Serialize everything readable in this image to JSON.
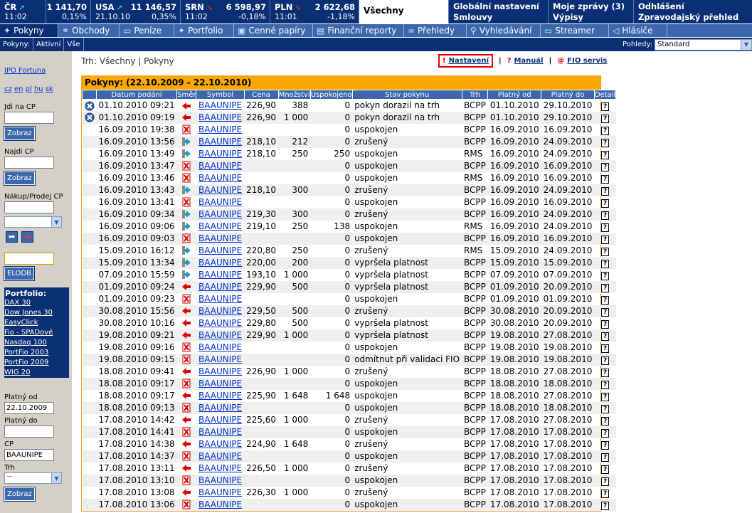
{
  "indices": [
    {
      "name": "ČR",
      "value": "1 141,70",
      "time": "11:02",
      "change": "0,15%",
      "dir": "up"
    },
    {
      "name": "USA",
      "value": "11 146,57",
      "time": "21.10.10",
      "change": "0,35%",
      "dir": "up"
    },
    {
      "name": "SRN",
      "value": "6 598,97",
      "time": "11:02",
      "change": "-0,18%",
      "dir": "dn"
    },
    {
      "name": "PLN",
      "value": "2 622,68",
      "time": "11:01",
      "change": "-1,18%",
      "dir": "dn"
    }
  ],
  "top_links": {
    "selected": "Všechny",
    "global_l1": "Globální nastavení",
    "global_l2": "Smlouvy",
    "messages_l1": "Moje zprávy (3)",
    "messages_l2": "Výpisy",
    "logout_l1": "Odhlášení",
    "logout_l2": "Zpravodajský přehled"
  },
  "nav": [
    "Pokyny",
    "Obchody",
    "Peníze",
    "Portfolio",
    "Cenné papíry",
    "Finanční reporty",
    "Přehledy",
    "Vyhledávání",
    "Streamer",
    "Hlásiče"
  ],
  "subnav": [
    "Pokyny:",
    "Aktivní",
    "Vše"
  ],
  "views": {
    "label": "Pohledy:",
    "value": "Standard"
  },
  "sidebar": {
    "ipo": "IPO Fortuna",
    "langs": [
      "cz",
      "en",
      "pl",
      "hu",
      "sk"
    ],
    "jdi_label": "Jdi na CP",
    "zobraz": "Zobraz",
    "najdi_label": "Najdi CP",
    "nakup_label": "Nákup/Prodej CP",
    "elodb": "ELODB",
    "portfolio_title": "Portfolio:",
    "portfolios": [
      "DAX 30",
      "Dow Jones 30",
      "EasyClick",
      "Fio - SPADové",
      "Nasdaq 100",
      "PortFio 2003",
      "PortFio 2009",
      "WIG 20"
    ],
    "platny_od_label": "Platný od",
    "platny_od": "22.10.2009",
    "platny_do_label": "Platný do",
    "platny_do": "",
    "cp_label": "CP",
    "cp": "BAAUNIPE",
    "trh_label": "Trh",
    "trh": "--"
  },
  "main": {
    "breadcrumb": "Trh: Všechny | Pokyny",
    "settings": "Nastavení",
    "manual": "Manuál",
    "fio": "FIO servis",
    "box_title": "Pokyny:  (22.10.2009 - 22.10.2010)",
    "headers": [
      "",
      "Datum podání",
      "Směr",
      "Symbol",
      "Cena",
      "Množství",
      "Uspokojeno",
      "Stav pokynu",
      "Trh",
      "Platný od",
      "Platný do",
      "Detail"
    ]
  },
  "rows": [
    {
      "s": "x",
      "d": "01.10.2010 09:21",
      "dir": "b",
      "sym": "BAAUNIPE",
      "p": "226,90",
      "q": "388",
      "f": "0",
      "st": "pokyn dorazil na trh",
      "m": "BCPP",
      "od": "01.10.2010",
      "do": "29.10.2010"
    },
    {
      "s": "x",
      "d": "01.10.2010 09:19",
      "dir": "b",
      "sym": "BAAUNIPE",
      "p": "226,90",
      "q": "1 000",
      "f": "0",
      "st": "pokyn dorazil na trh",
      "m": "BCPP",
      "od": "01.10.2010",
      "do": "29.10.2010"
    },
    {
      "s": "",
      "d": "16.09.2010 19:38",
      "dir": "c",
      "sym": "BAAUNIPE",
      "p": "",
      "q": "",
      "f": "0",
      "st": "uspokojen",
      "m": "BCPP",
      "od": "16.09.2010",
      "do": "16.09.2010"
    },
    {
      "s": "",
      "d": "16.09.2010 13:56",
      "dir": "s",
      "sym": "BAAUNIPE",
      "p": "218,10",
      "q": "212",
      "f": "0",
      "st": "zrušený",
      "m": "BCPP",
      "od": "16.09.2010",
      "do": "24.09.2010"
    },
    {
      "s": "",
      "d": "16.09.2010 13:49",
      "dir": "s",
      "sym": "BAAUNIPE",
      "p": "218,10",
      "q": "250",
      "f": "250",
      "st": "uspokojen",
      "m": "RMS",
      "od": "16.09.2010",
      "do": "24.09.2010"
    },
    {
      "s": "",
      "d": "16.09.2010 13:47",
      "dir": "c",
      "sym": "BAAUNIPE",
      "p": "",
      "q": "",
      "f": "0",
      "st": "uspokojen",
      "m": "BCPP",
      "od": "16.09.2010",
      "do": "16.09.2010"
    },
    {
      "s": "",
      "d": "16.09.2010 13:46",
      "dir": "c",
      "sym": "BAAUNIPE",
      "p": "",
      "q": "",
      "f": "0",
      "st": "uspokojen",
      "m": "RMS",
      "od": "16.09.2010",
      "do": "16.09.2010"
    },
    {
      "s": "",
      "d": "16.09.2010 13:43",
      "dir": "s",
      "sym": "BAAUNIPE",
      "p": "218,10",
      "q": "300",
      "f": "0",
      "st": "zrušený",
      "m": "BCPP",
      "od": "16.09.2010",
      "do": "24.09.2010"
    },
    {
      "s": "",
      "d": "16.09.2010 13:41",
      "dir": "c",
      "sym": "BAAUNIPE",
      "p": "",
      "q": "",
      "f": "0",
      "st": "uspokojen",
      "m": "BCPP",
      "od": "16.09.2010",
      "do": "16.09.2010"
    },
    {
      "s": "",
      "d": "16.09.2010 09:34",
      "dir": "s",
      "sym": "BAAUNIPE",
      "p": "219,30",
      "q": "300",
      "f": "0",
      "st": "zrušený",
      "m": "BCPP",
      "od": "16.09.2010",
      "do": "24.09.2010"
    },
    {
      "s": "",
      "d": "16.09.2010 09:06",
      "dir": "s",
      "sym": "BAAUNIPE",
      "p": "219,10",
      "q": "250",
      "f": "138",
      "st": "uspokojen",
      "m": "RMS",
      "od": "16.09.2010",
      "do": "24.09.2010"
    },
    {
      "s": "",
      "d": "16.09.2010 09:03",
      "dir": "c",
      "sym": "BAAUNIPE",
      "p": "",
      "q": "",
      "f": "0",
      "st": "uspokojen",
      "m": "BCPP",
      "od": "16.09.2010",
      "do": "16.09.2010"
    },
    {
      "s": "",
      "d": "15.09.2010 16:12",
      "dir": "s",
      "sym": "BAAUNIPE",
      "p": "220,80",
      "q": "250",
      "f": "0",
      "st": "zrušený",
      "m": "RMS",
      "od": "15.09.2010",
      "do": "24.09.2010"
    },
    {
      "s": "",
      "d": "15.09.2010 13:34",
      "dir": "s",
      "sym": "BAAUNIPE",
      "p": "220,00",
      "q": "200",
      "f": "0",
      "st": "vypršela platnost",
      "m": "BCPP",
      "od": "15.09.2010",
      "do": "15.09.2010"
    },
    {
      "s": "",
      "d": "07.09.2010 15:59",
      "dir": "s",
      "sym": "BAAUNIPE",
      "p": "193,10",
      "q": "1 000",
      "f": "0",
      "st": "vypršela platnost",
      "m": "BCPP",
      "od": "07.09.2010",
      "do": "07.09.2010"
    },
    {
      "s": "",
      "d": "01.09.2010 09:24",
      "dir": "b",
      "sym": "BAAUNIPE",
      "p": "229,90",
      "q": "500",
      "f": "0",
      "st": "vypršela platnost",
      "m": "BCPP",
      "od": "01.09.2010",
      "do": "20.09.2010"
    },
    {
      "s": "",
      "d": "01.09.2010 09:23",
      "dir": "c",
      "sym": "BAAUNIPE",
      "p": "",
      "q": "",
      "f": "0",
      "st": "uspokojen",
      "m": "BCPP",
      "od": "01.09.2010",
      "do": "01.09.2010"
    },
    {
      "s": "",
      "d": "30.08.2010 15:56",
      "dir": "b",
      "sym": "BAAUNIPE",
      "p": "229,50",
      "q": "500",
      "f": "0",
      "st": "zrušený",
      "m": "BCPP",
      "od": "30.08.2010",
      "do": "20.09.2010"
    },
    {
      "s": "",
      "d": "30.08.2010 10:16",
      "dir": "b",
      "sym": "BAAUNIPE",
      "p": "229,80",
      "q": "500",
      "f": "0",
      "st": "vypršela platnost",
      "m": "BCPP",
      "od": "30.08.2010",
      "do": "20.09.2010"
    },
    {
      "s": "",
      "d": "19.08.2010 09:21",
      "dir": "b",
      "sym": "BAAUNIPE",
      "p": "229,90",
      "q": "1 000",
      "f": "0",
      "st": "vypršela platnost",
      "m": "BCPP",
      "od": "19.08.2010",
      "do": "27.08.2010"
    },
    {
      "s": "",
      "d": "19.08.2010 09:16",
      "dir": "c",
      "sym": "BAAUNIPE",
      "p": "",
      "q": "",
      "f": "0",
      "st": "uspokojen",
      "m": "BCPP",
      "od": "19.08.2010",
      "do": "19.08.2010"
    },
    {
      "s": "",
      "d": "19.08.2010 09:15",
      "dir": "c",
      "sym": "BAAUNIPE",
      "p": "",
      "q": "",
      "f": "0",
      "st": "odmítnut při validaci FIO",
      "m": "BCPP",
      "od": "19.08.2010",
      "do": "19.08.2010"
    },
    {
      "s": "",
      "d": "18.08.2010 09:41",
      "dir": "b",
      "sym": "BAAUNIPE",
      "p": "226,90",
      "q": "1 000",
      "f": "0",
      "st": "zrušený",
      "m": "BCPP",
      "od": "18.08.2010",
      "do": "27.08.2010"
    },
    {
      "s": "",
      "d": "18.08.2010 09:17",
      "dir": "c",
      "sym": "BAAUNIPE",
      "p": "",
      "q": "",
      "f": "0",
      "st": "uspokojen",
      "m": "BCPP",
      "od": "18.08.2010",
      "do": "18.08.2010"
    },
    {
      "s": "",
      "d": "18.08.2010 09:17",
      "dir": "b",
      "sym": "BAAUNIPE",
      "p": "225,90",
      "q": "1 648",
      "f": "1 648",
      "st": "uspokojen",
      "m": "BCPP",
      "od": "18.08.2010",
      "do": "27.08.2010"
    },
    {
      "s": "",
      "d": "18.08.2010 09:13",
      "dir": "c",
      "sym": "BAAUNIPE",
      "p": "",
      "q": "",
      "f": "0",
      "st": "uspokojen",
      "m": "BCPP",
      "od": "18.08.2010",
      "do": "18.08.2010"
    },
    {
      "s": "",
      "d": "17.08.2010 14:42",
      "dir": "b",
      "sym": "BAAUNIPE",
      "p": "225,60",
      "q": "1 000",
      "f": "0",
      "st": "zrušený",
      "m": "BCPP",
      "od": "17.08.2010",
      "do": "27.08.2010"
    },
    {
      "s": "",
      "d": "17.08.2010 14:41",
      "dir": "c",
      "sym": "BAAUNIPE",
      "p": "",
      "q": "",
      "f": "0",
      "st": "uspokojen",
      "m": "BCPP",
      "od": "17.08.2010",
      "do": "17.08.2010"
    },
    {
      "s": "",
      "d": "17.08.2010 14:38",
      "dir": "b",
      "sym": "BAAUNIPE",
      "p": "224,90",
      "q": "1 648",
      "f": "0",
      "st": "zrušený",
      "m": "BCPP",
      "od": "17.08.2010",
      "do": "17.08.2010"
    },
    {
      "s": "",
      "d": "17.08.2010 14:37",
      "dir": "c",
      "sym": "BAAUNIPE",
      "p": "",
      "q": "",
      "f": "0",
      "st": "uspokojen",
      "m": "BCPP",
      "od": "17.08.2010",
      "do": "17.08.2010"
    },
    {
      "s": "",
      "d": "17.08.2010 13:11",
      "dir": "b",
      "sym": "BAAUNIPE",
      "p": "226,50",
      "q": "1 000",
      "f": "0",
      "st": "zrušený",
      "m": "BCPP",
      "od": "17.08.2010",
      "do": "17.08.2010"
    },
    {
      "s": "",
      "d": "17.08.2010 13:10",
      "dir": "c",
      "sym": "BAAUNIPE",
      "p": "",
      "q": "",
      "f": "0",
      "st": "uspokojen",
      "m": "BCPP",
      "od": "17.08.2010",
      "do": "17.08.2010"
    },
    {
      "s": "",
      "d": "17.08.2010 13:08",
      "dir": "b",
      "sym": "BAAUNIPE",
      "p": "226,30",
      "q": "1 000",
      "f": "0",
      "st": "zrušený",
      "m": "BCPP",
      "od": "17.08.2010",
      "do": "17.08.2010"
    },
    {
      "s": "",
      "d": "17.08.2010 13:06",
      "dir": "c",
      "sym": "BAAUNIPE",
      "p": "",
      "q": "",
      "f": "0",
      "st": "uspokojen",
      "m": "BCPP",
      "od": "17.08.2010",
      "do": "17.08.2010"
    }
  ]
}
